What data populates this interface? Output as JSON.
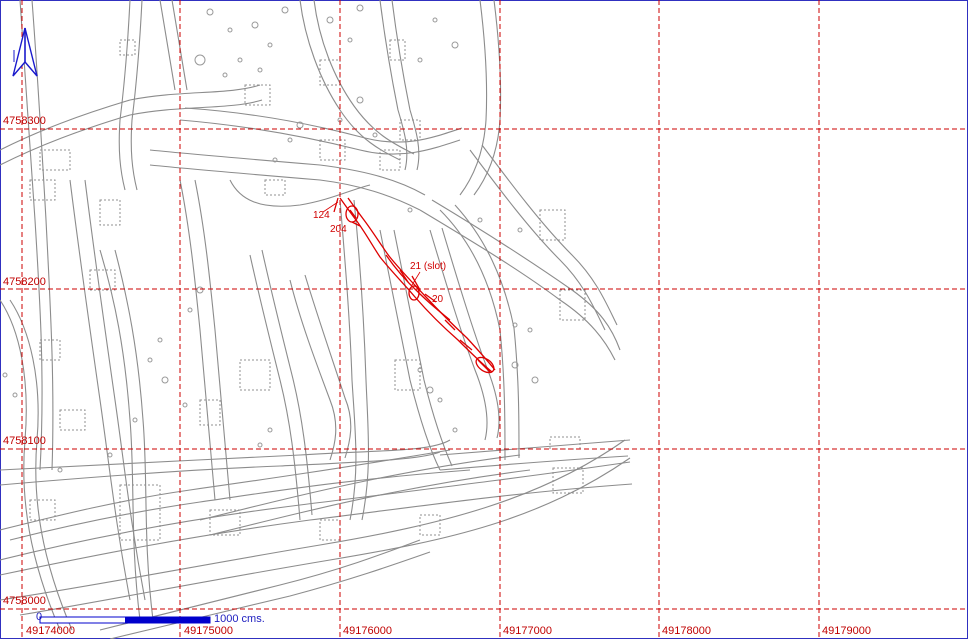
{
  "map": {
    "grid_x_labels": [
      "49174000",
      "49175000",
      "49176000",
      "49177000",
      "49178000",
      "49179000"
    ],
    "grid_y_labels": [
      "4758300",
      "4758200",
      "4758100",
      "4758000"
    ],
    "track_labels": [
      "124",
      "204",
      "21 (slot)",
      "20"
    ],
    "scale_bar_label": "1000 cms.",
    "scale_bar_zero": "0",
    "north_arrow": "north-arrow-icon",
    "colors": {
      "grid": "#cc0000",
      "features": "#8c8c8c",
      "highlight": "#dd0000",
      "scale": "#0000cc",
      "frame": "#3030c0"
    }
  }
}
